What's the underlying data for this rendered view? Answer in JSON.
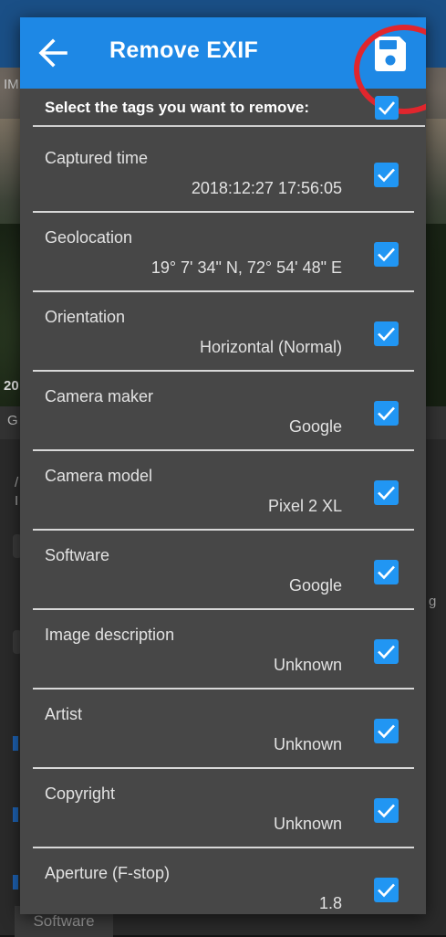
{
  "background": {
    "bottom_tab_label": "Software",
    "fragments": [
      "IM",
      "20",
      "G",
      "/",
      "I",
      "g"
    ]
  },
  "dialog": {
    "title": "Remove EXIF",
    "back_icon": "arrow-left-icon",
    "save_icon": "floppy-disk-icon",
    "header_color": "#1e88e5",
    "highlight_color": "#e0262d",
    "instruction": "Select the tags you want to remove:",
    "tags": [
      {
        "label": "Captured time",
        "value": "2018:12:27 17:56:05",
        "checked": true
      },
      {
        "label": "Geolocation",
        "value": "19° 7' 34\" N, 72° 54' 48\" E",
        "checked": true
      },
      {
        "label": "Orientation",
        "value": "Horizontal (Normal)",
        "checked": true
      },
      {
        "label": "Camera maker",
        "value": "Google",
        "checked": true
      },
      {
        "label": "Camera model",
        "value": "Pixel 2 XL",
        "checked": true
      },
      {
        "label": "Software",
        "value": "Google",
        "checked": true
      },
      {
        "label": "Image description",
        "value": "Unknown",
        "checked": true
      },
      {
        "label": "Artist",
        "value": "Unknown",
        "checked": true
      },
      {
        "label": "Copyright",
        "value": "Unknown",
        "checked": true
      },
      {
        "label": "Aperture (F-stop)",
        "value": "1.8",
        "checked": true
      }
    ]
  }
}
